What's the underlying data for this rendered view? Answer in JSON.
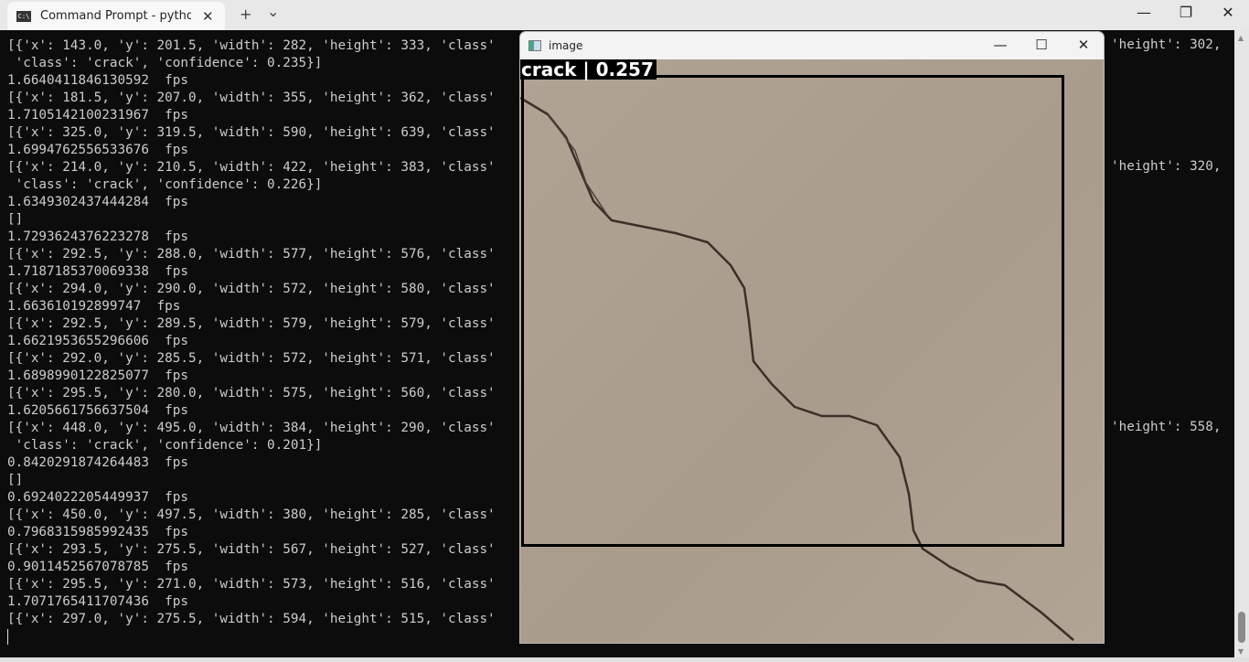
{
  "tabbar": {
    "tab_title": "Command Prompt - python w",
    "tab_icon": "cmd-icon",
    "new_tab": "+",
    "dropdown": "⌄",
    "minimize": "—",
    "restore": "❐",
    "close": "✕"
  },
  "terminal": {
    "lines": [
      "[{'x': 143.0, 'y': 201.5, 'width': 282, 'height': 333, 'class'",
      " 'class': 'crack', 'confidence': 0.235}]",
      "1.6640411846130592  fps",
      "[{'x': 181.5, 'y': 207.0, 'width': 355, 'height': 362, 'class'",
      "1.7105142100231967  fps",
      "[{'x': 325.0, 'y': 319.5, 'width': 590, 'height': 639, 'class'",
      "1.6994762556533676  fps",
      "[{'x': 214.0, 'y': 210.5, 'width': 422, 'height': 383, 'class'",
      " 'class': 'crack', 'confidence': 0.226}]",
      "1.6349302437444284  fps",
      "[]",
      "1.7293624376223278  fps",
      "[{'x': 292.5, 'y': 288.0, 'width': 577, 'height': 576, 'class'",
      "1.7187185370069338  fps",
      "[{'x': 294.0, 'y': 290.0, 'width': 572, 'height': 580, 'class'",
      "1.663610192899747  fps",
      "[{'x': 292.5, 'y': 289.5, 'width': 579, 'height': 579, 'class'",
      "1.6621953655296606  fps",
      "[{'x': 292.0, 'y': 285.5, 'width': 572, 'height': 571, 'class'",
      "1.6898990122825077  fps",
      "[{'x': 295.5, 'y': 280.0, 'width': 575, 'height': 560, 'class'",
      "1.6205661756637504  fps",
      "[{'x': 448.0, 'y': 495.0, 'width': 384, 'height': 290, 'class'",
      " 'class': 'crack', 'confidence': 0.201}]",
      "0.8420291874264483  fps",
      "[]",
      "0.6924022205449937  fps",
      "[{'x': 450.0, 'y': 497.5, 'width': 380, 'height': 285, 'class'",
      "0.7968315985992435  fps",
      "[{'x': 293.5, 'y': 275.5, 'width': 567, 'height': 527, 'class'",
      "0.9011452567078785  fps",
      "[{'x': 295.5, 'y': 271.0, 'width': 573, 'height': 516, 'class'",
      "1.7071765411707436  fps",
      "[{'x': 297.0, 'y': 275.5, 'width': 594, 'height': 515, 'class'"
    ],
    "right_fragments": [
      "'height': 302,",
      "'height': 320,",
      "'height': 558,"
    ]
  },
  "image_window": {
    "title": "image",
    "label": "crack | 0.257",
    "minimize": "—",
    "maximize": "☐",
    "close": "✕"
  }
}
